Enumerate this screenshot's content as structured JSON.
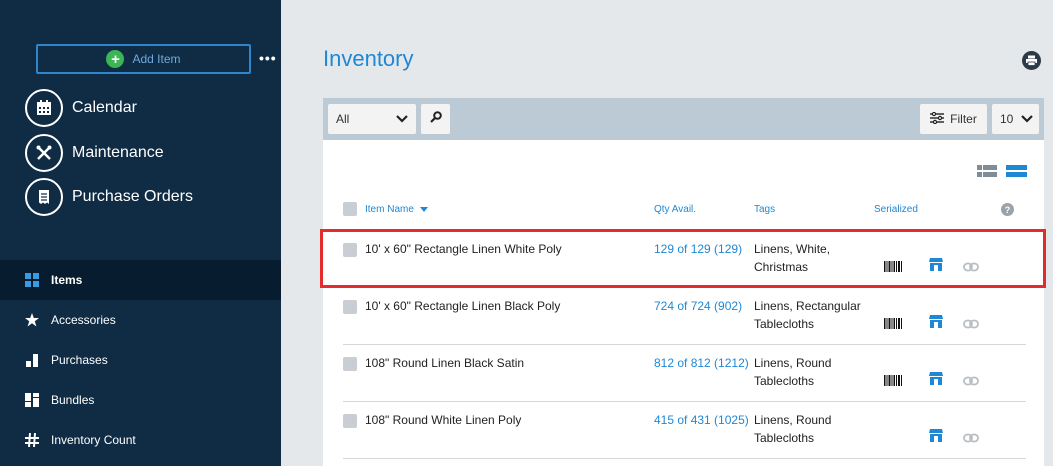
{
  "sidebar": {
    "add_item_label": "Add Item",
    "more_label": "•••",
    "big_nav": [
      {
        "label": "Calendar",
        "icon": "calendar-icon"
      },
      {
        "label": "Maintenance",
        "icon": "tools-icon"
      },
      {
        "label": "Purchase Orders",
        "icon": "receipt-icon"
      }
    ],
    "small_nav": [
      {
        "label": "Items",
        "icon": "grid-icon",
        "active": true
      },
      {
        "label": "Accessories",
        "icon": "star-icon"
      },
      {
        "label": "Purchases",
        "icon": "bar-icon"
      },
      {
        "label": "Bundles",
        "icon": "bundle-icon"
      },
      {
        "label": "Inventory Count",
        "icon": "hash-icon"
      }
    ]
  },
  "page": {
    "title": "Inventory"
  },
  "toolbar": {
    "select_value": "All",
    "filter_label": "Filter",
    "per_page": "10"
  },
  "table": {
    "headers": {
      "item_name": "Item Name",
      "qty_avail": "Qty Avail.",
      "tags": "Tags",
      "serialized": "Serialized",
      "help": "?"
    },
    "rows": [
      {
        "name": "10' x 60\" Rectangle Linen White Poly",
        "qty": "129 of 129 (129)",
        "tags": "Linens, White, Christmas",
        "barcode": true,
        "store": true,
        "link": true
      },
      {
        "name": "10' x 60\" Rectangle Linen Black Poly",
        "qty": "724 of 724 (902)",
        "tags": "Linens, Rectangular Tablecloths",
        "barcode": true,
        "store": true,
        "link": true
      },
      {
        "name": "108\" Round Linen Black Satin",
        "qty": "812 of 812 (1212)",
        "tags": "Linens, Round Tablecloths",
        "barcode": true,
        "store": true,
        "link": true
      },
      {
        "name": "108\" Round White Linen Poly",
        "qty": "415 of 431 (1025)",
        "tags": "Linens, Round Tablecloths",
        "barcode": false,
        "store": true,
        "link": true
      }
    ]
  },
  "colors": {
    "accent": "#1e88d4",
    "sidebar_bg": "#0f2c44",
    "highlight": "#e32c2c"
  }
}
